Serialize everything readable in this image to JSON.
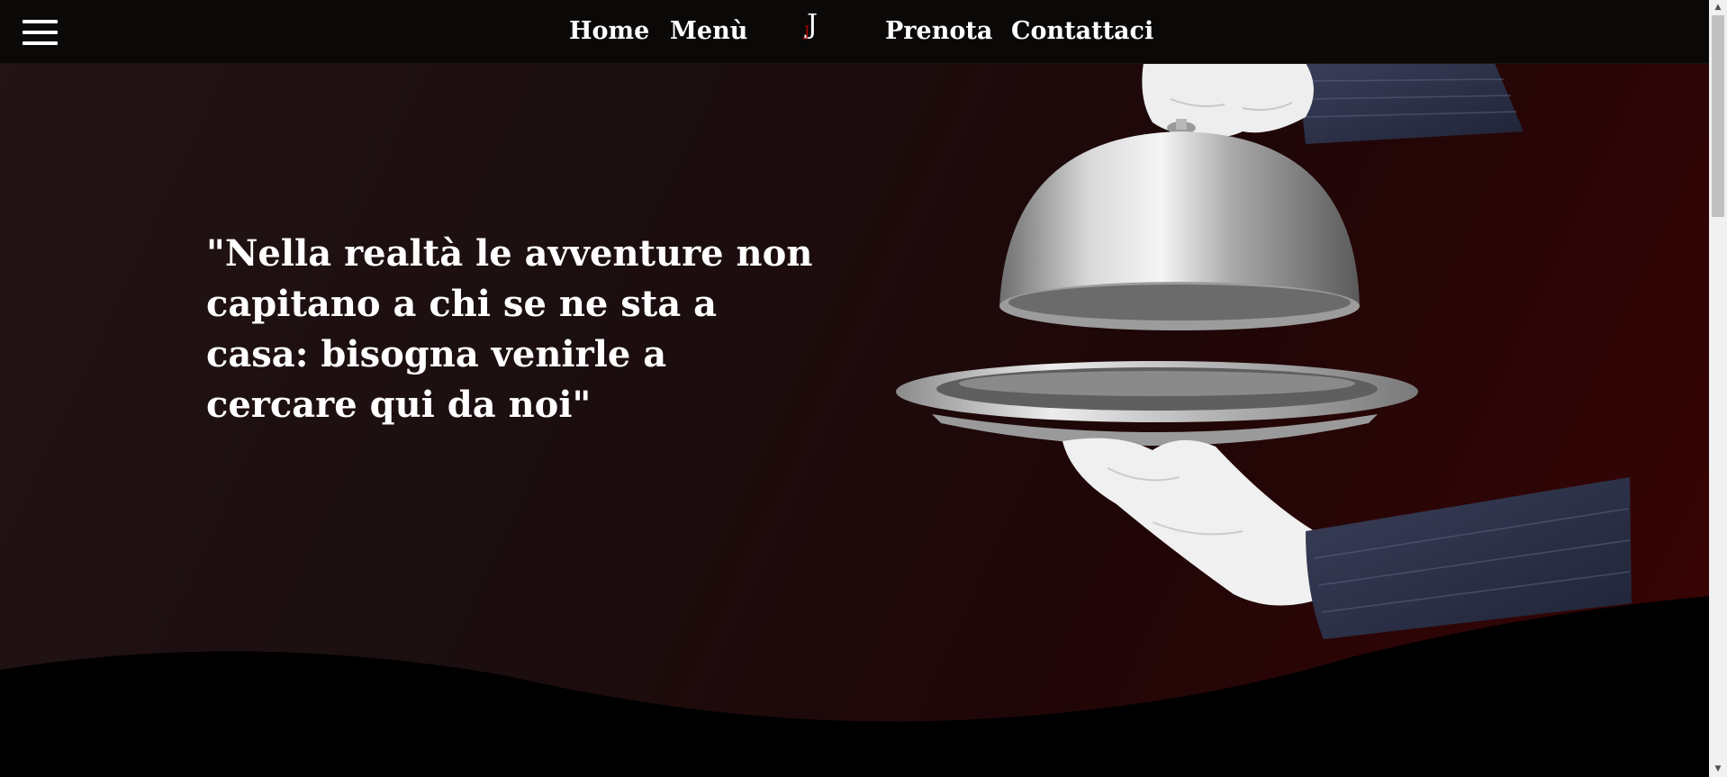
{
  "nav": {
    "menu_icon": "hamburger-icon",
    "links": {
      "home": "Home",
      "menu": "Menù",
      "prenota": "Prenota",
      "contattaci": "Contattaci"
    },
    "logo": {
      "main": "J",
      "accent": "J"
    }
  },
  "hero": {
    "quote": "\"Nella realtà le avventure non capitano a chi se ne sta a casa: bisogna venirle a cercare qui da noi\""
  },
  "illustration": {
    "icon": "waiter-cloche-icon"
  },
  "colors": {
    "navbar": "#0b0808",
    "accent": "#b00000",
    "text": "#ffffff",
    "background_dark": "#1c0f10",
    "background_red": "#3a0404"
  },
  "scrollbar": {
    "up": "▲",
    "down": "▼"
  }
}
